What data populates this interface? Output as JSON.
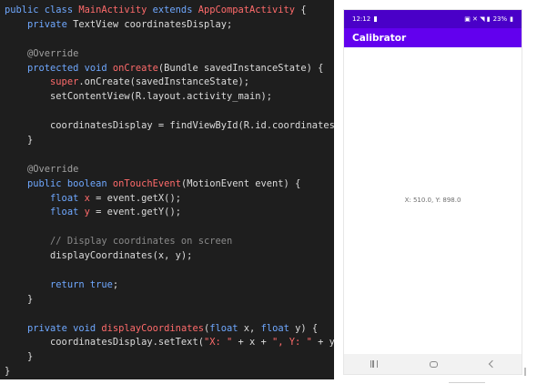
{
  "code_lines": [
    [
      [
        "kw",
        "public class "
      ],
      [
        "cls",
        "MainActivity "
      ],
      [
        "kw",
        "extends "
      ],
      [
        "cls",
        "AppCompatActivity"
      ],
      [
        "pl",
        " {"
      ]
    ],
    [
      [
        "pl",
        "    "
      ],
      [
        "kw",
        "private "
      ],
      [
        "pl",
        "TextView coordinatesDisplay;"
      ]
    ],
    [
      [
        "pl",
        ""
      ]
    ],
    [
      [
        "pl",
        "    "
      ],
      [
        "ann",
        "@Override"
      ]
    ],
    [
      [
        "pl",
        "    "
      ],
      [
        "kw",
        "protected void "
      ],
      [
        "fn",
        "onCreate"
      ],
      [
        "pl",
        "(Bundle savedInstanceState) {"
      ]
    ],
    [
      [
        "pl",
        "        "
      ],
      [
        "fn",
        "super"
      ],
      [
        "pl",
        ".onCreate(savedInstanceState);"
      ]
    ],
    [
      [
        "pl",
        "        setContentView(R.layout.activity_main);"
      ]
    ],
    [
      [
        "pl",
        ""
      ]
    ],
    [
      [
        "pl",
        "        coordinatesDisplay = findViewById(R.id.coordinatesText);"
      ]
    ],
    [
      [
        "pl",
        "    }"
      ]
    ],
    [
      [
        "pl",
        ""
      ]
    ],
    [
      [
        "pl",
        "    "
      ],
      [
        "ann",
        "@Override"
      ]
    ],
    [
      [
        "pl",
        "    "
      ],
      [
        "kw",
        "public boolean "
      ],
      [
        "fn",
        "onTouchEvent"
      ],
      [
        "pl",
        "(MotionEvent event) {"
      ]
    ],
    [
      [
        "pl",
        "        "
      ],
      [
        "kw",
        "float "
      ],
      [
        "fn",
        "x"
      ],
      [
        "pl",
        " = event.getX();"
      ]
    ],
    [
      [
        "pl",
        "        "
      ],
      [
        "kw",
        "float "
      ],
      [
        "fn",
        "y"
      ],
      [
        "pl",
        " = event.getY();"
      ]
    ],
    [
      [
        "pl",
        ""
      ]
    ],
    [
      [
        "pl",
        "        "
      ],
      [
        "cmt",
        "// Display coordinates on screen"
      ]
    ],
    [
      [
        "pl",
        "        displayCoordinates(x, y);"
      ]
    ],
    [
      [
        "pl",
        ""
      ]
    ],
    [
      [
        "pl",
        "        "
      ],
      [
        "kw",
        "return true"
      ],
      [
        "pl",
        ";"
      ]
    ],
    [
      [
        "pl",
        "    }"
      ]
    ],
    [
      [
        "pl",
        ""
      ]
    ],
    [
      [
        "pl",
        "    "
      ],
      [
        "kw",
        "private void "
      ],
      [
        "fn",
        "displayCoordinates"
      ],
      [
        "pl",
        "("
      ],
      [
        "kw",
        "float "
      ],
      [
        "pl",
        "x, "
      ],
      [
        "kw",
        "float "
      ],
      [
        "pl",
        "y) {"
      ]
    ],
    [
      [
        "pl",
        "        coordinatesDisplay.setText("
      ],
      [
        "str",
        "\"X: \""
      ],
      [
        "pl",
        " + x + "
      ],
      [
        "str",
        "\", Y: \""
      ],
      [
        "pl",
        " + y);"
      ]
    ],
    [
      [
        "pl",
        "    }"
      ]
    ],
    [
      [
        "pl",
        "}"
      ]
    ]
  ],
  "phone": {
    "status_time": "12:12",
    "status_right": "23%",
    "app_title": "Calibrator",
    "coords_text": "X: 510.0, Y: 898.0"
  }
}
